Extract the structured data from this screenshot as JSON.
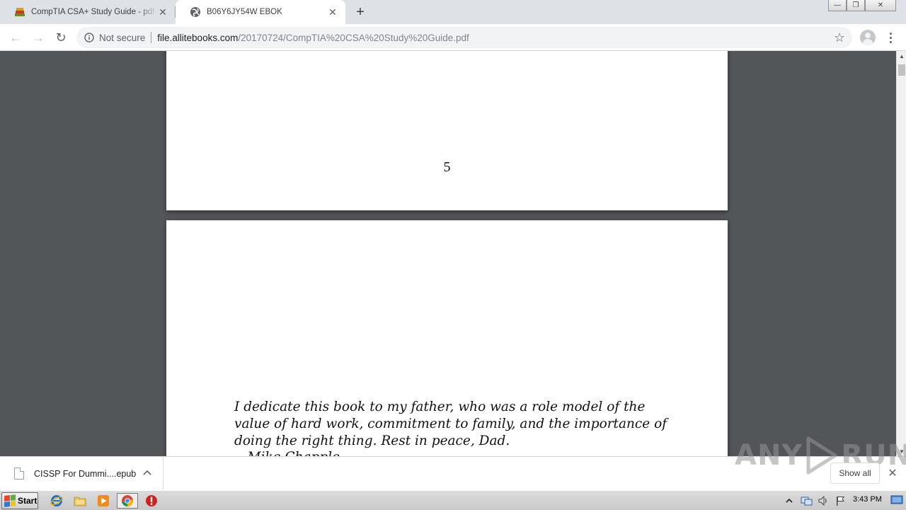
{
  "browser": {
    "tabs": [
      {
        "title": "CompTIA CSA+ Study Guide - pdf - F",
        "close_symbol": "✕",
        "active": false,
        "icon": "book-stack-icon"
      },
      {
        "title": "B06Y6JY54W EBOK",
        "close_symbol": "✕",
        "active": true,
        "icon": "globe-icon"
      }
    ],
    "new_tab_symbol": "+",
    "window_controls": {
      "minimize": "—",
      "restore": "❐",
      "close": "✕"
    },
    "toolbar": {
      "back_symbol": "←",
      "forward_symbol": "→",
      "reload_symbol": "↻",
      "security_label": "Not secure",
      "url_host": "file.allitebooks.com",
      "url_path": "/20170724/CompTIA%20CSA%20Study%20Guide.pdf",
      "bookmark_symbol": "☆"
    }
  },
  "document": {
    "page_number": "5",
    "dedication_lines": [
      "I dedicate this book to my father, who was a role model of the",
      "value of hard work, commitment to family, and the importance of",
      "doing the right thing. Rest in peace, Dad."
    ],
    "signature": "—Mike Chapple"
  },
  "downloads": {
    "item_name": "CISSP For Dummi....epub",
    "show_all_label": "Show all",
    "close_symbol": "✕"
  },
  "watermark": {
    "left_text": "ANY",
    "right_text": "RUN"
  },
  "taskbar": {
    "start_label": "Start",
    "clock": "3:43 PM",
    "start_flag_colors": [
      "#e8472b",
      "#5ab13a",
      "#2a7ad5",
      "#f5c111"
    ]
  },
  "colors": {
    "tab_strip": "#dee1e6",
    "viewer_background": "#525659",
    "omnibox": "#f1f3f4"
  }
}
